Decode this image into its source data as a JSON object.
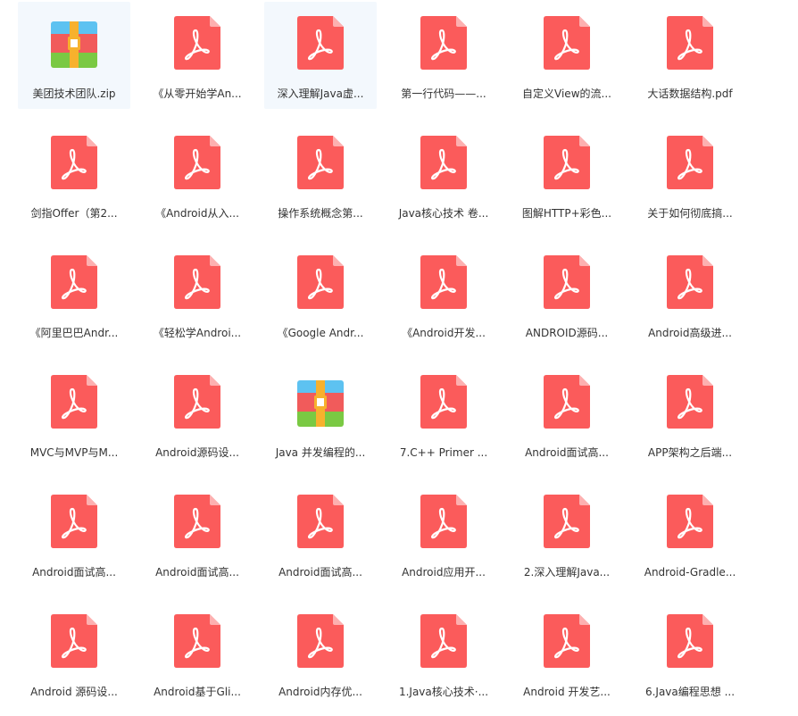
{
  "colors": {
    "pdf_body": "#fb5b5b",
    "pdf_fold": "#fdb0b0",
    "zip_top": "#5dc2f1",
    "zip_middle": "#f15b5b",
    "zip_bottom": "#7ac943",
    "zip_band": "#f7b12d",
    "label_text": "#333333",
    "selected_bg": "#f3f8fd"
  },
  "files": [
    {
      "name": "美团技术团队.zip",
      "icon": "zip-archive-icon",
      "selected": true
    },
    {
      "name": "《从零开始学An...",
      "icon": "pdf-file-icon",
      "selected": false
    },
    {
      "name": "深入理解Java虚...",
      "icon": "pdf-file-icon",
      "selected": true
    },
    {
      "name": "第一行代码——...",
      "icon": "pdf-file-icon",
      "selected": false
    },
    {
      "name": "自定义View的流...",
      "icon": "pdf-file-icon",
      "selected": false
    },
    {
      "name": "大话数据结构.pdf",
      "icon": "pdf-file-icon",
      "selected": false
    },
    {
      "name": "剑指Offer（第2...",
      "icon": "pdf-file-icon",
      "selected": false
    },
    {
      "name": "《Android从入...",
      "icon": "pdf-file-icon",
      "selected": false
    },
    {
      "name": "操作系统概念第...",
      "icon": "pdf-file-icon",
      "selected": false
    },
    {
      "name": "Java核心技术 卷...",
      "icon": "pdf-file-icon",
      "selected": false
    },
    {
      "name": "图解HTTP+彩色...",
      "icon": "pdf-file-icon",
      "selected": false
    },
    {
      "name": "关于如何彻底搞...",
      "icon": "pdf-file-icon",
      "selected": false
    },
    {
      "name": "《阿里巴巴Andr...",
      "icon": "pdf-file-icon",
      "selected": false
    },
    {
      "name": "《轻松学Androi...",
      "icon": "pdf-file-icon",
      "selected": false
    },
    {
      "name": "《Google Andr...",
      "icon": "pdf-file-icon",
      "selected": false
    },
    {
      "name": "《Android开发...",
      "icon": "pdf-file-icon",
      "selected": false
    },
    {
      "name": "ANDROID源码...",
      "icon": "pdf-file-icon",
      "selected": false
    },
    {
      "name": "Android高级进...",
      "icon": "pdf-file-icon",
      "selected": false
    },
    {
      "name": "MVC与MVP与M...",
      "icon": "pdf-file-icon",
      "selected": false
    },
    {
      "name": "Android源码设...",
      "icon": "pdf-file-icon",
      "selected": false
    },
    {
      "name": "Java 并发编程的...",
      "icon": "zip-archive-icon",
      "selected": false
    },
    {
      "name": "7.C++ Primer ...",
      "icon": "pdf-file-icon",
      "selected": false
    },
    {
      "name": "Android面试高...",
      "icon": "pdf-file-icon",
      "selected": false
    },
    {
      "name": "APP架构之后端...",
      "icon": "pdf-file-icon",
      "selected": false
    },
    {
      "name": "Android面试高...",
      "icon": "pdf-file-icon",
      "selected": false
    },
    {
      "name": "Android面试高...",
      "icon": "pdf-file-icon",
      "selected": false
    },
    {
      "name": "Android面试高...",
      "icon": "pdf-file-icon",
      "selected": false
    },
    {
      "name": "Android应用开...",
      "icon": "pdf-file-icon",
      "selected": false
    },
    {
      "name": "2.深入理解Java...",
      "icon": "pdf-file-icon",
      "selected": false
    },
    {
      "name": "Android-Gradle...",
      "icon": "pdf-file-icon",
      "selected": false
    },
    {
      "name": "Android 源码设...",
      "icon": "pdf-file-icon",
      "selected": false
    },
    {
      "name": "Android基于Gli...",
      "icon": "pdf-file-icon",
      "selected": false
    },
    {
      "name": "Android内存优...",
      "icon": "pdf-file-icon",
      "selected": false
    },
    {
      "name": "1.Java核心技术·...",
      "icon": "pdf-file-icon",
      "selected": false
    },
    {
      "name": "Android 开发艺...",
      "icon": "pdf-file-icon",
      "selected": false
    },
    {
      "name": "6.Java编程思想 ...",
      "icon": "pdf-file-icon",
      "selected": false
    }
  ]
}
